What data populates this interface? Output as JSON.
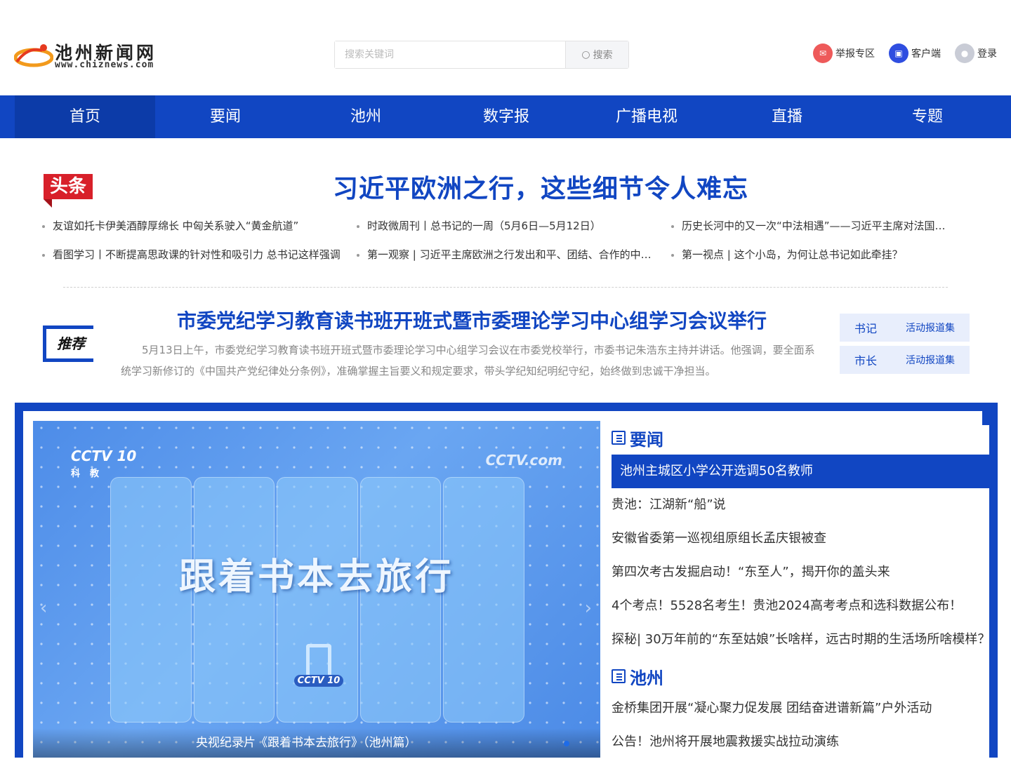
{
  "site": {
    "name": "池州新闻网",
    "url": "www.chiznews.com"
  },
  "search": {
    "placeholder": "搜索关键词",
    "button_label": "搜索"
  },
  "tools": [
    {
      "label": "举报专区",
      "icon": "report-icon",
      "color": "#ee5a5a"
    },
    {
      "label": "客户端",
      "icon": "app-icon",
      "color": "#2f4ee0"
    },
    {
      "label": "登录",
      "icon": "user-icon",
      "color": "#c9ccd6"
    }
  ],
  "nav": {
    "items": [
      "首页",
      "要闻",
      "池州",
      "数字报",
      "广播电视",
      "直播",
      "专题"
    ],
    "active_index": 0
  },
  "headline": {
    "tag": "头条",
    "title": "习近平欧洲之行，这些细节令人难忘",
    "links": [
      "友谊如托卡伊美酒醇厚绵长 中匈关系驶入“黄金航道”",
      "时政微周刊丨总书记的一周（5月6日—5月12日）",
      "历史长河中的又一次“中法相遇”——习近平主席对法国进行国事访问",
      "看图学习丨不断提高思政课的针对性和吸引力 总书记这样强调",
      "第一观察 | 习近平主席欧洲之行发出和平、团结、合作的中国声音",
      "第一视点 | 这个小岛，为何让总书记如此牵挂？"
    ]
  },
  "recommend": {
    "tag": "推荐",
    "title": "市委党纪学习教育读书班开班式暨市委理论学习中心组学习会议举行",
    "desc": "5月13日上午，市委党纪学习教育读书班开班式暨市委理论学习中心组学习会议在市委党校举行，市委书记朱浩东主持并讲话。他强调，要全面系统学习新修订的《中国共产党纪律处分条例》，准确掌握主旨要义和规定要求，带头学纪知纪明纪守纪，始终做到忠诚干净担当。",
    "leaders": [
      {
        "who": "书记",
        "what": "活动报道集"
      },
      {
        "who": "市长",
        "what": "活动报道集"
      }
    ]
  },
  "slider": {
    "big_text": "跟着书本去旅行",
    "logo_left": "CCTV 10",
    "logo_left_sub": "科教",
    "logo_right": "CCTV.com",
    "logo_center": "CCTV 10",
    "caption": "央视纪录片《跟着书本去旅行》（池州篇）",
    "prev": "‹",
    "next": "›"
  },
  "sections": [
    {
      "title": "要闻",
      "items": [
        "池州主城区小学公开选调50名教师",
        "贵池：江湖新“船”说",
        "安徽省委第一巡视组原组长孟庆银被查",
        "第四次考古发掘启动！“东至人”，揭开你的盖头来",
        "4个考点！5528名考生！贵池2024高考考点和选科数据公布！",
        "探秘| 30万年前的“东至姑娘”长啥样，远古时期的生活场所啥模样？"
      ],
      "active_index": 0
    },
    {
      "title": "池州",
      "items": [
        "金桥集团开展“凝心聚力促发展 团结奋进谱新篇”户外活动",
        "公告！池州将开展地震救援实战拉动演练"
      ],
      "active_index": -1
    }
  ],
  "colors": {
    "brand_blue": "#1146c2",
    "nav_active": "#0c3ba8",
    "headline_tag_red": "#d8202a",
    "leader_bg": "#e8eefc"
  }
}
